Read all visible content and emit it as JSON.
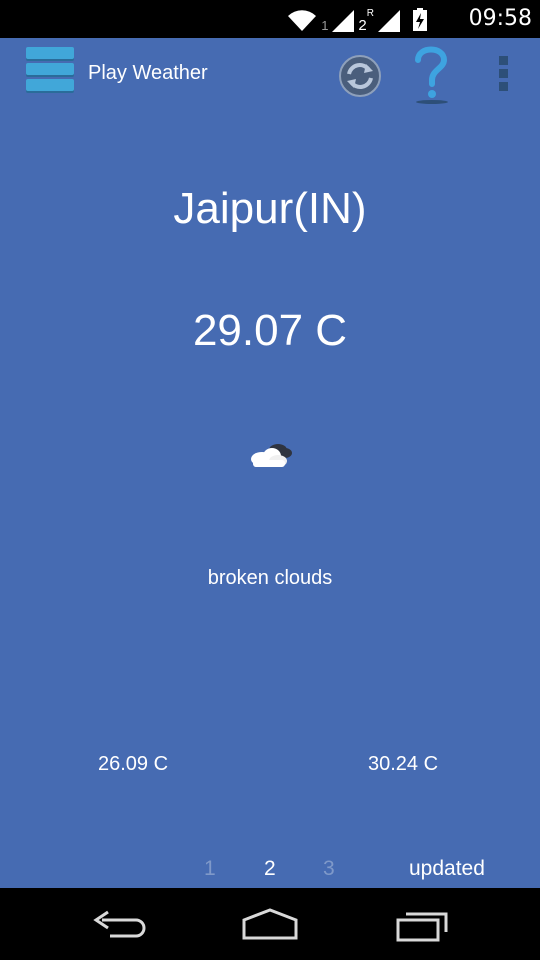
{
  "status_bar": {
    "sim1_label": "1",
    "sim2_label": "2",
    "roaming_label": "R",
    "time": "09:58",
    "icons": [
      "wifi-icon",
      "signal-icon",
      "battery-charging-icon"
    ]
  },
  "action_bar": {
    "title": "Play Weather",
    "icons": [
      "menu-icon",
      "refresh-icon",
      "help-icon",
      "overflow-menu-icon"
    ]
  },
  "weather": {
    "city": "Jaipur(IN)",
    "temperature": "29.07 C",
    "icon": "broken-clouds-icon",
    "description": "broken clouds",
    "temp_min": "26.09 C",
    "temp_max": "30.24 C"
  },
  "pager": {
    "pages": [
      "1",
      "2",
      "3"
    ],
    "current": "2",
    "updated_label": "updated"
  },
  "colors": {
    "background": "#466bb2",
    "menu_icon": "#41a7d9",
    "inactive_page": "#7f99c9"
  },
  "nav_bar": {
    "icons": [
      "back-icon",
      "home-icon",
      "recent-apps-icon"
    ]
  }
}
